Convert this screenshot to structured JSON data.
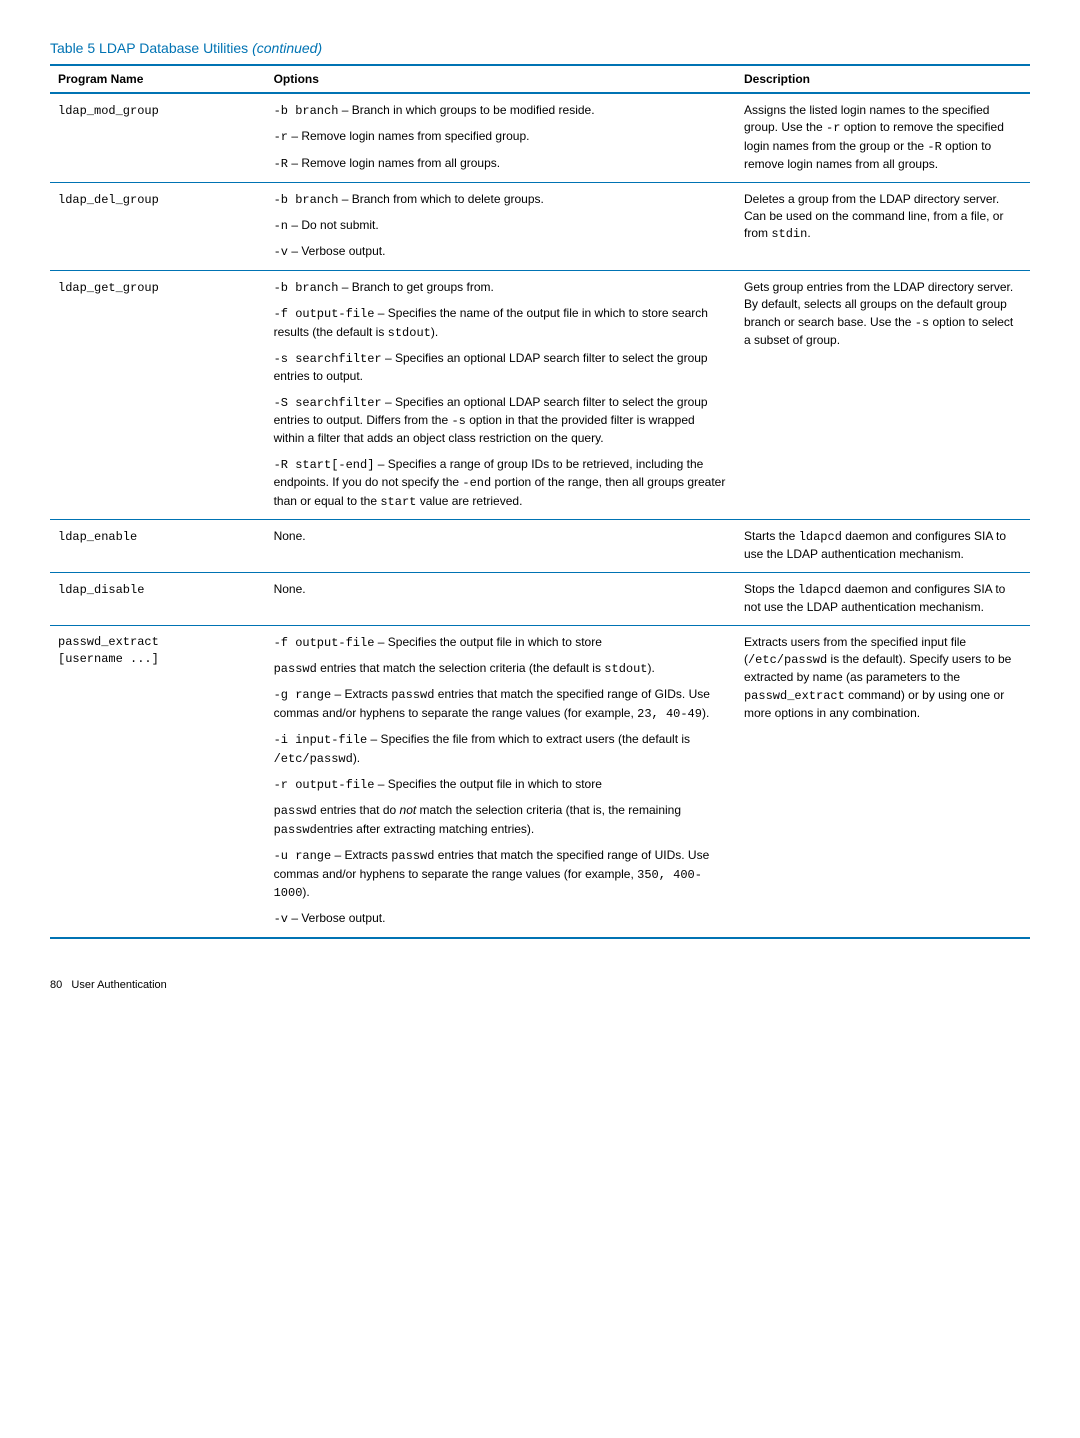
{
  "table_title_prefix": "Table 5 LDAP Database Utilities ",
  "table_title_suffix": "(continued)",
  "headers": {
    "c1": "Program Name",
    "c2": "Options",
    "c3": "Description"
  },
  "row1": {
    "name": "ldap_mod_group",
    "o1a": "-b branch",
    "o1b": " – Branch in which groups to be modified reside.",
    "o2a": "-r",
    "o2b": " – Remove login names from specified group.",
    "o3a": "-R",
    "o3b": " – Remove login names from all groups.",
    "d1": "Assigns the listed login names to the specified group. Use the ",
    "d2": "-r",
    "d3": " option to remove the specified login names from the group or the ",
    "d4": "-R",
    "d5": " option to remove login names from all groups."
  },
  "row2": {
    "name": "ldap_del_group",
    "o1a": "-b branch",
    "o1b": " – Branch from which to delete groups.",
    "o2a": "-n",
    "o2b": " – Do not submit.",
    "o3a": "-v",
    "o3b": " – Verbose output.",
    "d1": "Deletes a group from the LDAP directory server. Can be used on the command line, from a file, or from ",
    "d2": "stdin",
    "d3": "."
  },
  "row3": {
    "name": "ldap_get_group",
    "o1a": "-b branch",
    "o1b": " – Branch to get groups from.",
    "o2a": "-f output-file",
    "o2b": " – Specifies the name of the output file in which to store search results (the default is ",
    "o2c": "stdout",
    "o2d": ").",
    "o3a": "-s searchfilter",
    "o3b": " – Specifies an optional LDAP search filter to select the group entries to output.",
    "o4a": "-S searchfilter",
    "o4b": " – Specifies an optional LDAP search filter to select the group entries to output. Differs from the ",
    "o4c": "-s",
    "o4d": " option in that the provided filter is wrapped within a filter that adds an object class restriction on the query.",
    "o5a": "-R start[-end]",
    "o5b": " – Specifies a range of group IDs to be retrieved, including the endpoints. If you do not specify the ",
    "o5c": "-end",
    "o5d": " portion of the range, then all groups greater than or equal to the ",
    "o5e": "start",
    "o5f": " value are retrieved.",
    "d1": "Gets group entries from the LDAP directory server. By default, selects all groups on the default group branch or search base. Use the ",
    "d2": "-s",
    "d3": " option to select a subset of group."
  },
  "row4": {
    "name": "ldap_enable",
    "opts": "None.",
    "d1": "Starts the ",
    "d2": "ldapcd",
    "d3": " daemon and configures SIA to use the LDAP authentication mechanism."
  },
  "row5": {
    "name": "ldap_disable",
    "opts": "None.",
    "d1": "Stops the ",
    "d2": "ldapcd",
    "d3": " daemon and configures SIA to not use the LDAP authentication mechanism."
  },
  "row6": {
    "name_l1": "passwd_extract",
    "name_l2": "[username ...]",
    "o1a": "-f output-file",
    "o1b": " – Specifies the output file in which to store",
    "o2a": "passwd",
    "o2b": " entries that match the selection criteria (the default is ",
    "o2c": "stdout",
    "o2d": ").",
    "o3a": "-g range",
    "o3b": " – Extracts ",
    "o3c": "passwd",
    "o3d": " entries that match the specified range of GIDs. Use commas and/or hyphens to separate the range values (for example, ",
    "o3e": "23, 40-49",
    "o3f": ").",
    "o4a": "-i input-file",
    "o4b": " – Specifies the file from which to extract users (the default is ",
    "o4c": "/etc/passwd",
    "o4d": ").",
    "o5a": "-r output-file",
    "o5b": " – Specifies the output file in which to store",
    "o6a": "passwd",
    "o6b": " entries that do ",
    "o6c": "not",
    "o6d": " match the selection criteria (that is, the remaining ",
    "o6e": "passwd",
    "o6f": "entries after extracting matching entries).",
    "o7a": "-u range",
    "o7b": " – Extracts ",
    "o7c": "passwd",
    "o7d": " entries that match the specified range of UIDs. Use commas and/or hyphens to separate the range values (for example, ",
    "o7e": "350, 400-1000",
    "o7f": ").",
    "o8a": "-v",
    "o8b": " – Verbose output.",
    "d1": "Extracts users from the specified input file (",
    "d2": "/etc/passwd",
    "d3": " is the default). Specify users to be extracted by name (as parameters to the ",
    "d4": "passwd_extract",
    "d5": " command) or by using one or more options in any combination."
  },
  "footer": "80   User Authentication"
}
